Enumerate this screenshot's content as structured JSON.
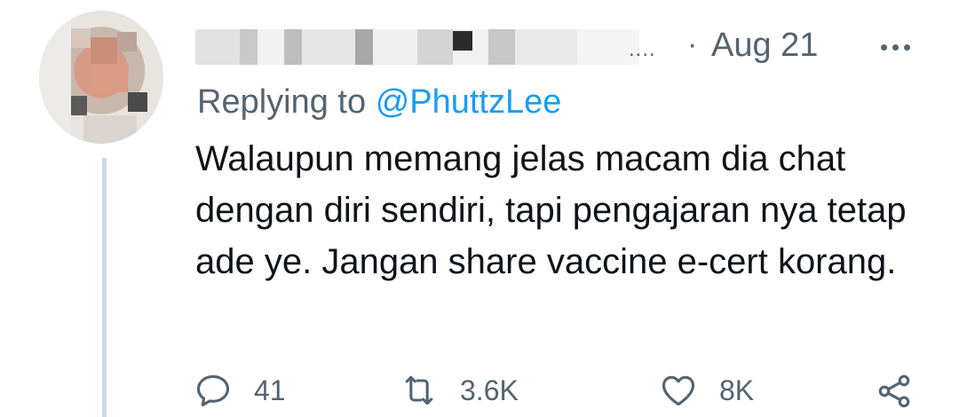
{
  "tweet": {
    "author_name": "",
    "meta": {
      "ellipsis": "....",
      "separator": "·",
      "date": "Aug 21"
    },
    "more_icon": "more-horizontal-icon",
    "reply": {
      "prefix": "Replying to",
      "handle": "@PhuttzLee"
    },
    "text": "Walaupun memang jelas macam dia chat dengan diri sendiri, tapi pengajaran nya tetap ade ye. Jangan share vaccine e-cert korang.",
    "actions": [
      {
        "name": "reply",
        "icon": "reply-icon",
        "count": "41"
      },
      {
        "name": "retweet",
        "icon": "retweet-icon",
        "count": "3.6K"
      },
      {
        "name": "like",
        "icon": "heart-icon",
        "count": "8K"
      },
      {
        "name": "share",
        "icon": "share-icon",
        "count": ""
      }
    ]
  },
  "colors": {
    "primary_text": "#0f1419",
    "secondary_text": "#536471",
    "link": "#1d9bf0",
    "thread_line": "#cfd9de"
  }
}
